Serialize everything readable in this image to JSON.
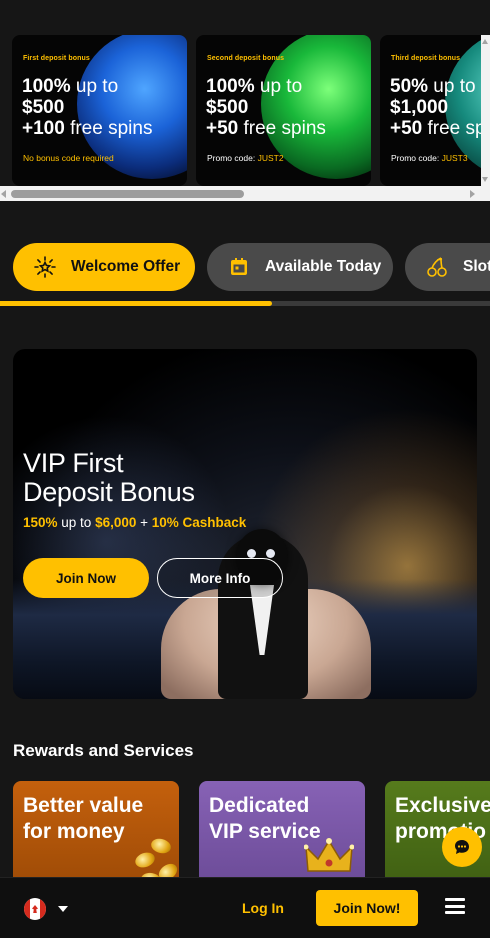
{
  "promos": [
    {
      "tag": "First deposit bonus",
      "amount_bold": "100%",
      "amount_thin": " up to",
      "line2": "$500",
      "line3_bold": "+100",
      "line3_thin": " free spins",
      "foot_text": "No bonus code required",
      "foot_code": ""
    },
    {
      "tag": "Second deposit bonus",
      "amount_bold": "100%",
      "amount_thin": " up to",
      "line2": "$500",
      "line3_bold": "+50",
      "line3_thin": " free spins",
      "foot_text": "Promo code: ",
      "foot_code": "JUST2"
    },
    {
      "tag": "Third deposit bonus",
      "amount_bold": "50%",
      "amount_thin": " up to",
      "line2": "$1,000",
      "line3_bold": "+50",
      "line3_thin": " free sp",
      "foot_text": "Promo code: ",
      "foot_code": "JUST3"
    }
  ],
  "categories": [
    {
      "label": "Welcome Offer",
      "icon": "sparkle-sun-icon",
      "active": true
    },
    {
      "label": "Available Today",
      "icon": "calendar-icon",
      "active": false
    },
    {
      "label": "Slots",
      "icon": "cherries-icon",
      "active": false
    }
  ],
  "category_progress": 0.555,
  "hero": {
    "title_line1": "VIP First",
    "title_line2": "Deposit Bonus",
    "offer_pct": "150%",
    "offer_upto": " up to ",
    "offer_amount": "$6,000",
    "offer_plus": " + ",
    "offer_cashback": "10% Cashback",
    "join_label": "Join Now",
    "more_label": "More Info"
  },
  "rewards": {
    "title": "Rewards and Services",
    "cards": [
      {
        "line1": "Better value",
        "line2": "for money"
      },
      {
        "line1": "Dedicated",
        "line2": "VIP service"
      },
      {
        "line1": "Exclusive",
        "line2": "promotio"
      }
    ]
  },
  "bottom_bar": {
    "country": "Canada",
    "login_label": "Log In",
    "join_label": "Join Now!"
  },
  "colors": {
    "accent": "#ffc000",
    "background": "#161616",
    "pill_inactive": "#4a4a4a"
  }
}
